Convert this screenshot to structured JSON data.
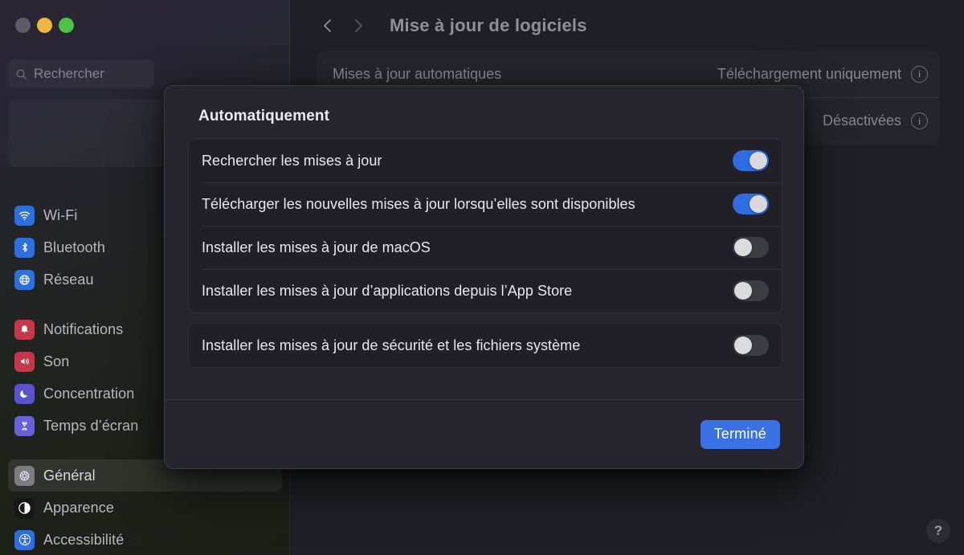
{
  "window": {
    "traffic_lights": [
      {
        "name": "close",
        "color": "#5e5a68"
      },
      {
        "name": "minimize",
        "color": "#f0b541"
      },
      {
        "name": "zoom",
        "color": "#4fc04a"
      }
    ]
  },
  "sidebar": {
    "search": {
      "value": "",
      "placeholder": "Rechercher",
      "icon": "search-icon"
    },
    "groups": [
      {
        "items": [
          {
            "key": "wifi",
            "label": "Wi-Fi",
            "icon": "wifi-icon",
            "color": "#2f6fdc",
            "selected": false
          },
          {
            "key": "bluetooth",
            "label": "Bluetooth",
            "icon": "bluetooth-icon",
            "color": "#2f6fdc",
            "selected": false
          },
          {
            "key": "network",
            "label": "Réseau",
            "icon": "globe-icon",
            "color": "#2f6fdc",
            "selected": false
          }
        ]
      },
      {
        "items": [
          {
            "key": "notifications",
            "label": "Notifications",
            "icon": "bell-icon",
            "color": "#c3384a",
            "selected": false
          },
          {
            "key": "sound",
            "label": "Son",
            "icon": "speaker-icon",
            "color": "#c3384a",
            "selected": false
          },
          {
            "key": "focus",
            "label": "Concentration",
            "icon": "moon-icon",
            "color": "#5a54cc",
            "selected": false
          },
          {
            "key": "screentime",
            "label": "Temps d’écran",
            "icon": "hourglass-icon",
            "color": "#5a54cc",
            "selected": false
          }
        ]
      },
      {
        "items": [
          {
            "key": "general",
            "label": "Général",
            "icon": "gear-icon",
            "color": "#7c7c82",
            "selected": true
          },
          {
            "key": "appearance",
            "label": "Apparence",
            "icon": "appearance-icon",
            "color": "#17171a",
            "selected": false
          },
          {
            "key": "accessibility",
            "label": "Accessibilité",
            "icon": "accessibility-icon",
            "color": "#2f6fdc",
            "selected": false
          }
        ]
      }
    ]
  },
  "toolbar": {
    "back_icon": "chevron-left-icon",
    "forward_icon": "chevron-right-icon",
    "title": "Mise à jour de logiciels"
  },
  "main": {
    "rows": [
      {
        "label": "Mises à jour automatiques",
        "value": "Téléchargement uniquement",
        "info_icon": "info-icon"
      },
      {
        "label": "",
        "value": "Désactivées",
        "info_icon": "info-icon"
      }
    ],
    "help_label": "?"
  },
  "sheet": {
    "title": "Automatiquement",
    "groups": [
      {
        "options": [
          {
            "key": "check",
            "label": "Rechercher les mises à jour",
            "state": "on"
          },
          {
            "key": "download",
            "label": "Télécharger les nouvelles mises à jour lorsqu’elles sont disponibles",
            "state": "on"
          },
          {
            "key": "install-macos",
            "label": "Installer les mises à jour de macOS",
            "state": "off"
          },
          {
            "key": "install-appstore",
            "label": "Installer les mises à jour d’applications depuis l’App Store",
            "state": "off"
          }
        ]
      },
      {
        "options": [
          {
            "key": "install-security",
            "label": "Installer les mises à jour de sécurité et les fichiers système",
            "state": "off"
          }
        ]
      }
    ],
    "done_label": "Terminé"
  },
  "colors": {
    "accent": "#3a72e6",
    "switch_on": "#2f6ce0",
    "switch_off": "#3c3c44",
    "sheet_bg": "#26252d",
    "card_bg": "#212029",
    "main_bg": "#1e2025"
  }
}
